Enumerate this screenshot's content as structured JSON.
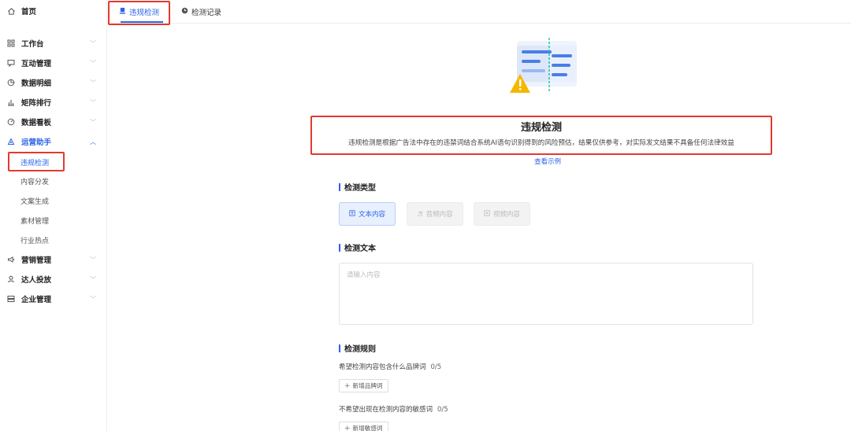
{
  "sidebar": {
    "home": {
      "label": "首页",
      "icon": "home-icon"
    },
    "items": [
      {
        "label": "工作台",
        "icon": "grid-icon"
      },
      {
        "label": "互动管理",
        "icon": "chat-icon"
      },
      {
        "label": "数据明细",
        "icon": "chart-circle-icon"
      },
      {
        "label": "矩阵排行",
        "icon": "bar-chart-icon"
      },
      {
        "label": "数据看板",
        "icon": "dashboard-icon"
      },
      {
        "label": "运营助手",
        "icon": "assistant-icon",
        "active": true
      },
      {
        "label": "营销管理",
        "icon": "megaphone-icon"
      },
      {
        "label": "达人投放",
        "icon": "user-icon"
      },
      {
        "label": "企业管理",
        "icon": "enterprise-icon"
      }
    ],
    "sub_items": [
      {
        "label": "违规检测",
        "active": true
      },
      {
        "label": "内容分发"
      },
      {
        "label": "文案生成"
      },
      {
        "label": "素材管理"
      },
      {
        "label": "行业热点"
      }
    ]
  },
  "tabs": [
    {
      "label": "违规检测",
      "active": true
    },
    {
      "label": "检测记录"
    }
  ],
  "main": {
    "title": "违规检测",
    "description": "违规检测是根据广告法中存在的违禁词结合系统AI语句识别得到的风险预估，结果仅供参考，对实际发文结果不具备任何法律效益",
    "example_link": "查看示例",
    "section_type": "检测类型",
    "types": [
      {
        "label": "文本内容",
        "active": true
      },
      {
        "label": "音频内容"
      },
      {
        "label": "视频内容"
      }
    ],
    "section_text": "检测文本",
    "text_placeholder": "请输入内容",
    "section_rules": "检测规则",
    "rule1": {
      "label": "希望检测内容包含什么品牌词",
      "count": "0/5",
      "button": "新增品牌词"
    },
    "rule2": {
      "label": "不希望出现在检测内容的敏感词",
      "count": "0/5",
      "button": "新增敏感词"
    }
  },
  "colors": {
    "accent": "#2b63e8",
    "highlight": "#e23a30",
    "warning": "#f5b800"
  }
}
